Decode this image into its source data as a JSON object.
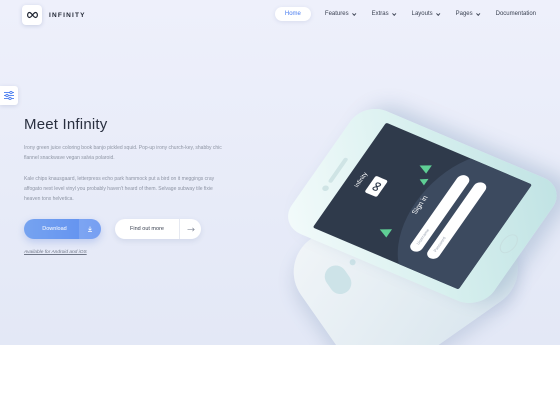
{
  "brand": {
    "name": "INFINITY"
  },
  "nav": {
    "items": [
      {
        "label": "Home",
        "active": true
      },
      {
        "label": "Features",
        "dropdown": true
      },
      {
        "label": "Extras",
        "dropdown": true
      },
      {
        "label": "Layouts",
        "dropdown": true
      },
      {
        "label": "Pages",
        "dropdown": true
      },
      {
        "label": "Documentation",
        "dropdown": false
      }
    ]
  },
  "hero": {
    "title": "Meet Infinity",
    "paragraph1": "Irony green juice coloring book banjo pickled squid. Pop-up irony church-key, shabby chic flannel snackwave vegan salvia polaroid.",
    "paragraph2": "Kale chips knausgaard, letterpress echo park hammock put a bird on it meggings cray affogato next level vinyl you probably haven't heard of them. Selvage subway tile fixie heaven tonx helvetica.",
    "download_label": "Download",
    "find_out_label": "Find out more",
    "availability": "Available for Android and iOS"
  },
  "phone_screen": {
    "app_name": "Infinity",
    "sign_in": "Sign in",
    "field1_placeholder": "Username",
    "field2_placeholder": "Password"
  },
  "colors": {
    "accent": "#5f8ff0",
    "hero_bg": "#eaedf9",
    "screen_bg": "#2f3a4b",
    "tree_green": "#5fcf95"
  },
  "icons": {
    "brand": "infinity-icon",
    "settings": "sliders-icon",
    "download": "download-arrow-icon",
    "find_out": "arrow-right-icon"
  }
}
